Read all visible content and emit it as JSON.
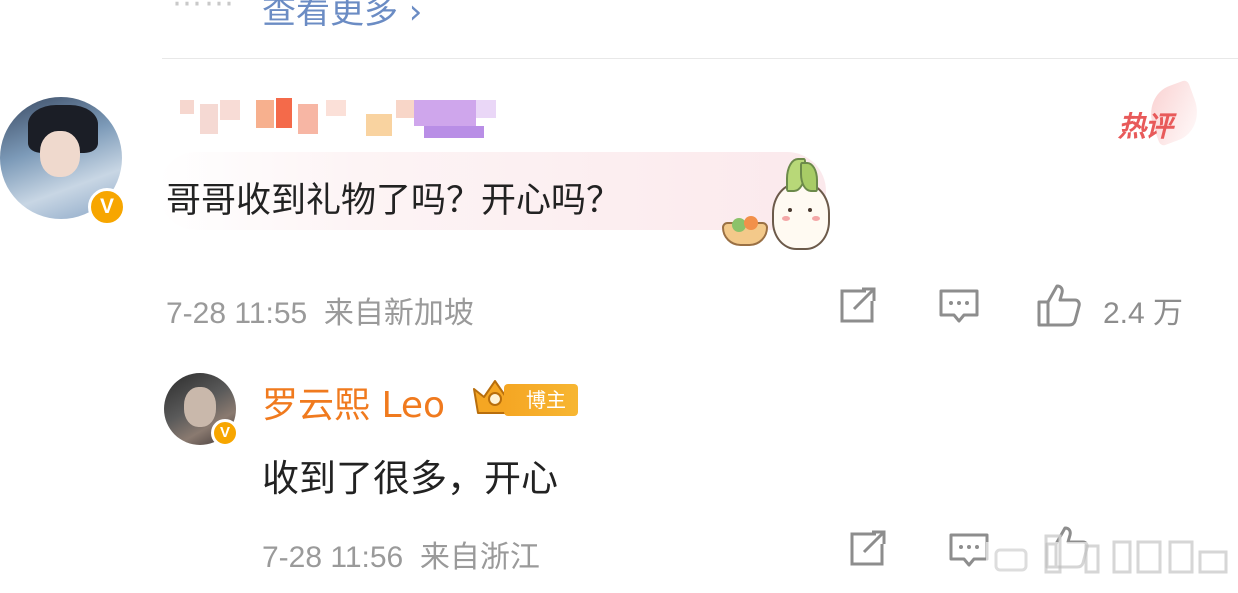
{
  "top": {
    "dots": "⋯⋯",
    "view_more": "查看更多 ›"
  },
  "comment": {
    "hot_label": "热评",
    "text": "哥哥收到礼物了吗？开心吗？",
    "time": "7-28 11:55",
    "location": "来自新加坡",
    "likes": "2.4 万",
    "icons": [
      "share-icon",
      "comment-icon",
      "like-icon"
    ]
  },
  "reply": {
    "username": "罗云熙 Leo",
    "badge": "博主",
    "text": "收到了很多，开心",
    "time": "7-28 11:56",
    "location": "来自浙江",
    "icons": [
      "share-icon",
      "comment-icon",
      "like-icon"
    ]
  },
  "colors": {
    "accent_orange": "#f07a1e",
    "verified": "#f7a600",
    "link_blue": "#6b8cc4",
    "hot_red": "#e85a5a",
    "meta_gray": "#9a9a9a"
  }
}
